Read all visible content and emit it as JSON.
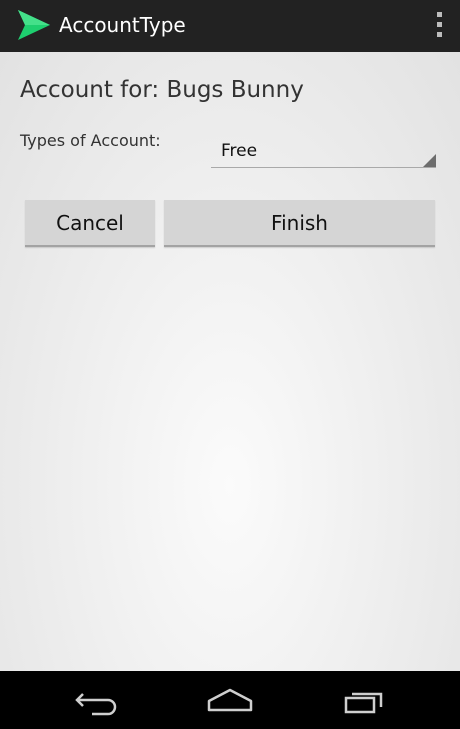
{
  "action_bar": {
    "title": "AccountType",
    "icon": "send-arrow-icon",
    "overflow_icon": "overflow-menu-icon",
    "accent": "#1ecf6f",
    "background": "#222222"
  },
  "form": {
    "heading": "Account for: Bugs Bunny",
    "types_label": "Types of Account:",
    "account_type": {
      "selected": "Free"
    },
    "buttons": {
      "cancel": "Cancel",
      "finish": "Finish"
    }
  },
  "nav_bar": {
    "back_icon": "back-icon",
    "home_icon": "home-icon",
    "recent_icon": "recent-apps-icon"
  }
}
